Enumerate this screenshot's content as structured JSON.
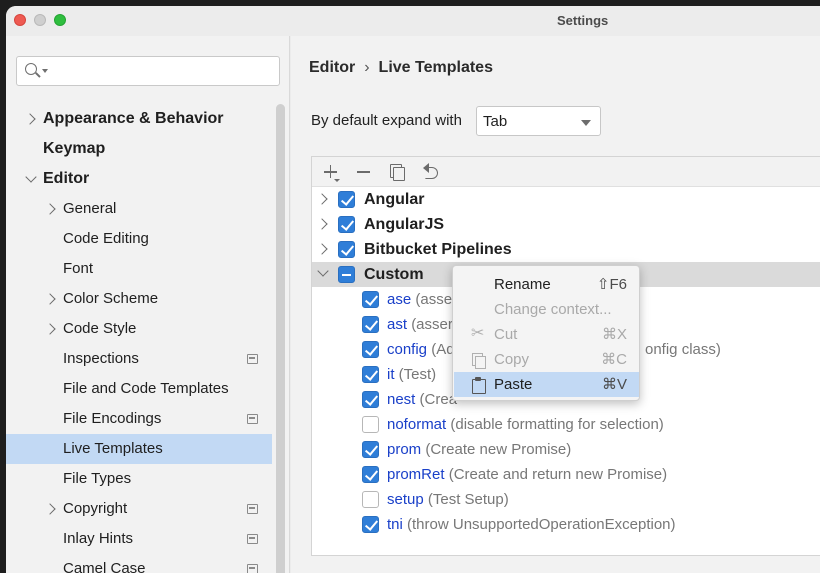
{
  "window": {
    "title": "Settings"
  },
  "search": {
    "placeholder": ""
  },
  "sidebar": {
    "items": [
      {
        "label": "Appearance & Behavior",
        "level": 0,
        "expander": "collapsed",
        "bold": true
      },
      {
        "label": "Keymap",
        "level": 0,
        "expander": "none",
        "bold": true
      },
      {
        "label": "Editor",
        "level": 0,
        "expander": "expanded",
        "bold": true
      },
      {
        "label": "General",
        "level": 1,
        "expander": "collapsed"
      },
      {
        "label": "Code Editing",
        "level": 1,
        "expander": "none"
      },
      {
        "label": "Font",
        "level": 1,
        "expander": "none"
      },
      {
        "label": "Color Scheme",
        "level": 1,
        "expander": "collapsed"
      },
      {
        "label": "Code Style",
        "level": 1,
        "expander": "collapsed"
      },
      {
        "label": "Inspections",
        "level": 1,
        "expander": "none",
        "project_icon": true
      },
      {
        "label": "File and Code Templates",
        "level": 1,
        "expander": "none"
      },
      {
        "label": "File Encodings",
        "level": 1,
        "expander": "none",
        "project_icon": true
      },
      {
        "label": "Live Templates",
        "level": 1,
        "expander": "none",
        "selected": true
      },
      {
        "label": "File Types",
        "level": 1,
        "expander": "none"
      },
      {
        "label": "Copyright",
        "level": 1,
        "expander": "collapsed",
        "project_icon": true
      },
      {
        "label": "Inlay Hints",
        "level": 1,
        "expander": "none",
        "project_icon": true
      },
      {
        "label": "Camel Case",
        "level": 1,
        "expander": "none",
        "project_icon": true
      }
    ]
  },
  "main": {
    "breadcrumb": {
      "parent": "Editor",
      "separator": "›",
      "current": "Live Templates"
    },
    "expand_label": "By default expand with",
    "expand_value": "Tab",
    "toolbar": [
      "add-icon",
      "remove-icon",
      "copy-icon",
      "undo-icon"
    ],
    "groups": [
      {
        "name": "Angular",
        "state": "checked",
        "expander": "collapsed"
      },
      {
        "name": "AngularJS",
        "state": "checked",
        "expander": "collapsed"
      },
      {
        "name": "Bitbucket Pipelines",
        "state": "checked",
        "expander": "collapsed"
      },
      {
        "name": "Custom",
        "state": "indeterminate",
        "expander": "expanded",
        "highlight": true
      }
    ],
    "templates": [
      {
        "abbr": "ase",
        "desc": "(assert",
        "checked": true
      },
      {
        "abbr": "ast",
        "desc": "(assert",
        "checked": true
      },
      {
        "abbr": "config",
        "desc": "(Ad",
        "desc_tail": "onfig class)",
        "checked": true
      },
      {
        "abbr": "it",
        "desc": "(Test)",
        "checked": true
      },
      {
        "abbr": "nest",
        "desc": "(Crea",
        "checked": true
      },
      {
        "abbr": "noformat",
        "desc": "(disable formatting for selection)",
        "checked": false
      },
      {
        "abbr": "prom",
        "desc": "(Create new Promise)",
        "checked": true
      },
      {
        "abbr": "promRet",
        "desc": "(Create and return new Promise)",
        "checked": true
      },
      {
        "abbr": "setup",
        "desc": "(Test Setup)",
        "checked": false
      },
      {
        "abbr": "tni",
        "desc": "(throw UnsupportedOperationException)",
        "checked": true
      }
    ]
  },
  "context_menu": {
    "items": [
      {
        "label": "Rename",
        "shortcut": "⇧F6",
        "enabled": true,
        "icon": ""
      },
      {
        "label": "Change context...",
        "shortcut": "",
        "enabled": false,
        "icon": ""
      },
      {
        "label": "Cut",
        "shortcut": "⌘X",
        "enabled": false,
        "icon": "cut-icon"
      },
      {
        "label": "Copy",
        "shortcut": "⌘C",
        "enabled": false,
        "icon": "copy-icon"
      },
      {
        "label": "Paste",
        "shortcut": "⌘V",
        "enabled": true,
        "active": true,
        "icon": "paste-icon"
      }
    ]
  },
  "colors": {
    "selection": "#c2d9f4",
    "checkbox": "#2f7ed8",
    "abbr_link": "#1a40c9"
  }
}
